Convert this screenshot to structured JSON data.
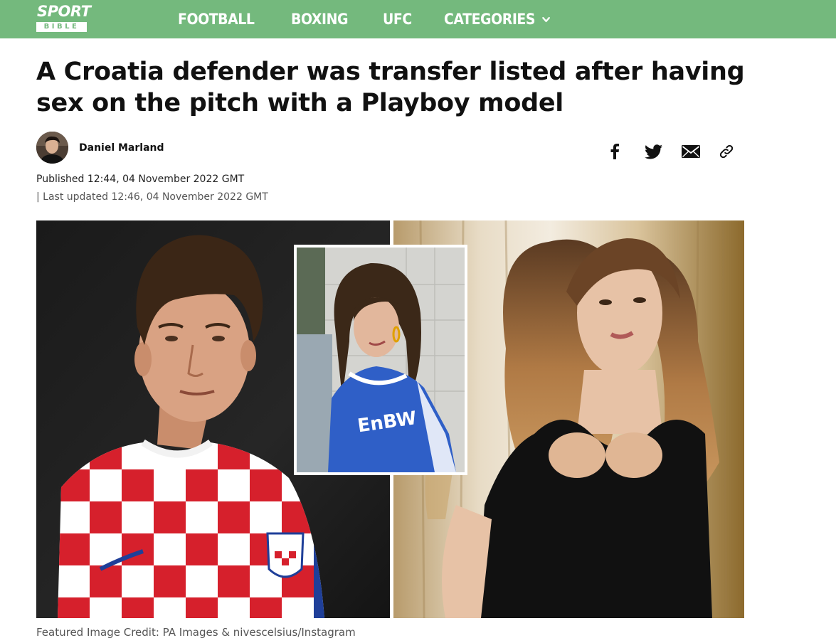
{
  "header": {
    "logo_top": "SPORT",
    "logo_bottom": "BIBLE",
    "brand_color": "#74b97d",
    "nav": [
      {
        "label": "FOOTBALL"
      },
      {
        "label": "BOXING"
      },
      {
        "label": "UFC"
      },
      {
        "label": "CATEGORIES"
      }
    ]
  },
  "article": {
    "title": "A Croatia defender was transfer listed after having sex on the pitch with a Playboy model",
    "author": "Daniel Marland",
    "published": "Published 12:44, 04 November 2022 GMT",
    "updated": "| Last updated 12:46, 04 November 2022 GMT",
    "share_icons": [
      "facebook-icon",
      "twitter-icon",
      "email-icon",
      "link-icon"
    ],
    "image_caption": "Featured Image Credit: PA Images & nivescelsius/Instagram",
    "shirt_text": "EnBW"
  }
}
